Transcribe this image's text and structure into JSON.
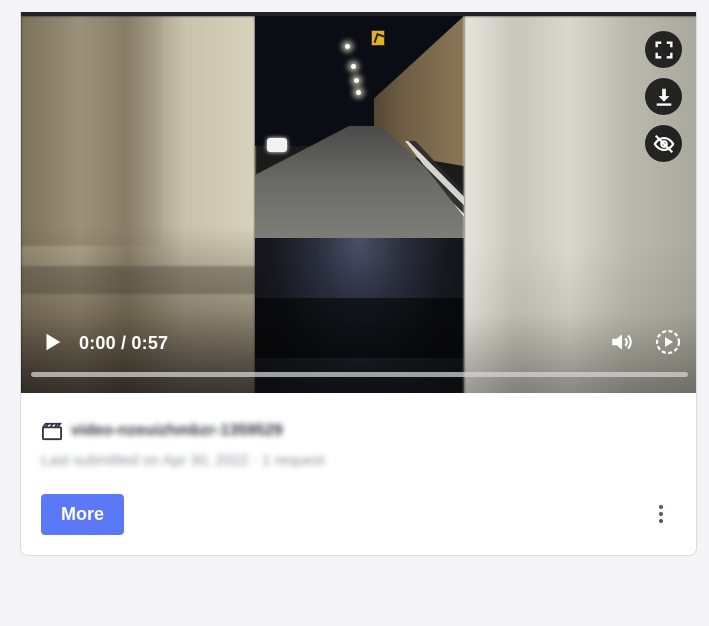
{
  "player": {
    "time_display": "0:00 / 0:57",
    "progress": 0.0,
    "controls": {
      "play_icon": "play-icon",
      "volume_icon": "volume-icon",
      "playback_speed_icon": "playback-speed-icon",
      "fullscreen_icon": "fullscreen-icon",
      "download_icon": "download-icon",
      "hide_icon": "eye-off-icon"
    }
  },
  "item": {
    "title": "video-nzeuizhmbzr-1359529",
    "subtitle": "Last submitted on Apr 30, 2022 · 1 request",
    "type_icon": "film-clapper-icon"
  },
  "actions": {
    "more_label": "More",
    "menu_icon": "kebab-menu-icon"
  },
  "colors": {
    "accent": "#5b78f6",
    "page_bg": "#f4f4f6",
    "card_border": "#d9dbe3",
    "title_text": "#2f3342",
    "subtitle_text": "#8b8f9c"
  }
}
